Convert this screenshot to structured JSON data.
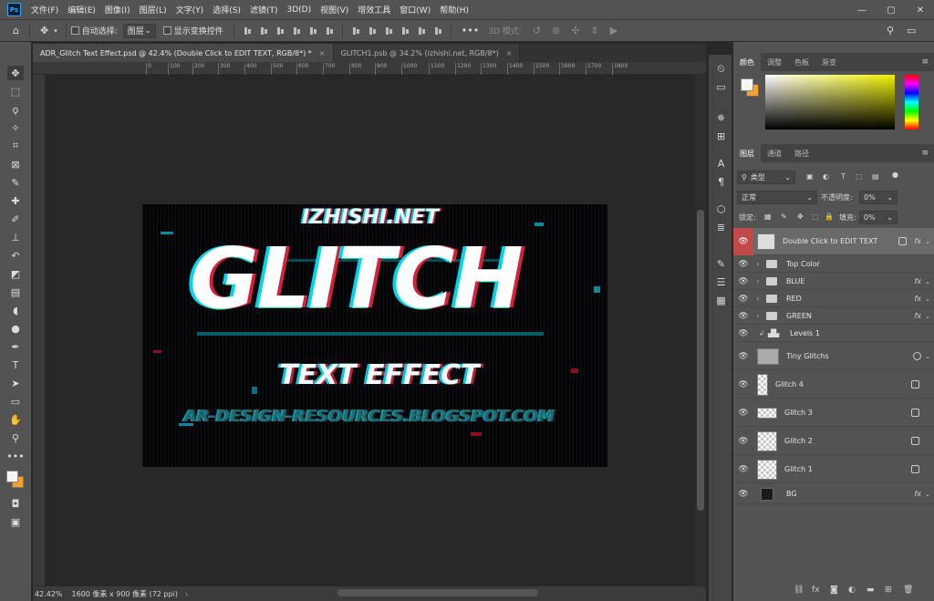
{
  "menubar": {
    "logo": "Ps",
    "items": [
      "文件(F)",
      "编辑(E)",
      "图像(I)",
      "图层(L)",
      "文字(Y)",
      "选择(S)",
      "滤镜(T)",
      "3D(D)",
      "视图(V)",
      "增效工具",
      "窗口(W)",
      "帮助(H)"
    ]
  },
  "options": {
    "auto_select_label": "自动选择:",
    "auto_select_value": "图层",
    "show_transform_label": "显示变换控件",
    "mode_3d_label": "3D 模式:"
  },
  "tabs": [
    {
      "label": "ADR_Glitch Text Effect.psd @ 42.4% (Double Click to EDIT TEXT, RGB/8*) *",
      "active": true
    },
    {
      "label": "GLITCH1.psb @ 34.2% (izhishi.net, RGB/8*)",
      "active": false
    }
  ],
  "ruler_ticks": [
    "0",
    "100",
    "200",
    "300",
    "400",
    "500",
    "600",
    "700",
    "800",
    "900",
    "1000",
    "1100",
    "1200",
    "1300",
    "1400",
    "1500",
    "1600",
    "1700",
    "1800"
  ],
  "canvas": {
    "top_text": "IZHISHI.NET",
    "main_text": "GLITCH",
    "sub_text": "TEXT EFFECT",
    "bottom_text": "AR-DESIGN-RESOURCES.BLOGSPOT.COM"
  },
  "status": {
    "zoom": "42.42%",
    "doc_size": "1600 像素 x 900 像素 (72 ppi)"
  },
  "color_panel": {
    "tabs": [
      "颜色",
      "调整",
      "色板",
      "渐变"
    ],
    "foreground": "#f5f5f5",
    "background": "#f6a030"
  },
  "layers_panel": {
    "tabs": [
      "图层",
      "通道",
      "路径"
    ],
    "filter_label": "类型",
    "blend_mode": "正常",
    "opacity_label": "不透明度:",
    "opacity_value": "0%",
    "lock_label": "锁定:",
    "fill_label": "填充:",
    "fill_value": "0%",
    "layers": [
      {
        "name": "Double Click to EDIT TEXT",
        "kind": "smart",
        "fx": true,
        "selected": true
      },
      {
        "name": "Top Color",
        "kind": "folder",
        "fx": false
      },
      {
        "name": "BLUE",
        "kind": "folder",
        "fx": true
      },
      {
        "name": "RED",
        "kind": "folder",
        "fx": true
      },
      {
        "name": "GREEN",
        "kind": "folder",
        "fx": true
      },
      {
        "name": "Levels 1",
        "kind": "adjustment",
        "fx": false
      },
      {
        "name": "Tiny Glitchs",
        "kind": "smart",
        "fx": false
      },
      {
        "name": "Glitch 4",
        "kind": "layer",
        "fx": false
      },
      {
        "name": "Glitch 3",
        "kind": "layer",
        "fx": false
      },
      {
        "name": "Glitch 2",
        "kind": "layer",
        "fx": false
      },
      {
        "name": "Glitch 1",
        "kind": "layer",
        "fx": false
      },
      {
        "name": "BG",
        "kind": "bg",
        "fx": true
      }
    ],
    "fx_label": "fx"
  }
}
